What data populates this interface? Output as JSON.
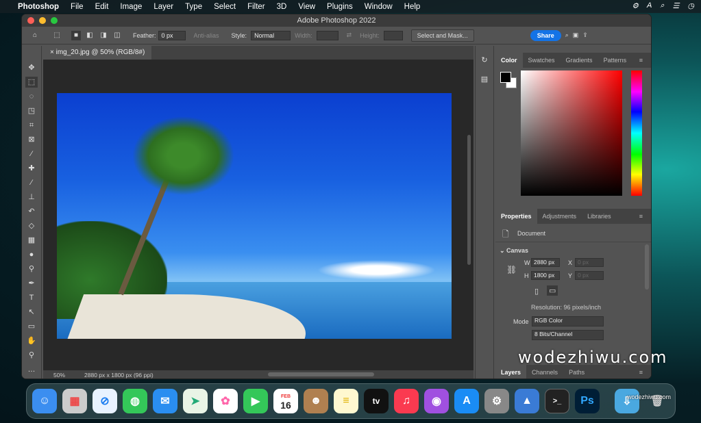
{
  "menubar": {
    "app": "Photoshop",
    "items": [
      "File",
      "Edit",
      "Image",
      "Layer",
      "Type",
      "Select",
      "Filter",
      "3D",
      "View",
      "Plugins",
      "Window",
      "Help"
    ]
  },
  "window": {
    "title": "Adobe Photoshop 2022"
  },
  "options": {
    "feather_label": "Feather:",
    "feather_value": "0 px",
    "antialias": "Anti-alias",
    "style_label": "Style:",
    "style_value": "Normal",
    "width_label": "Width:",
    "height_label": "Height:",
    "select_mask": "Select and Mask...",
    "share": "Share"
  },
  "document": {
    "tab": "img_20.jpg @ 50% (RGB/8#)",
    "zoom": "50%",
    "size": "2880 px x 1800 px (96 ppi)"
  },
  "color_panel": {
    "tabs": [
      "Color",
      "Swatches",
      "Gradients",
      "Patterns"
    ]
  },
  "properties": {
    "tabs": [
      "Properties",
      "Adjustments",
      "Libraries"
    ],
    "doc_label": "Document",
    "section": "Canvas",
    "w_label": "W",
    "w_value": "2880 px",
    "h_label": "H",
    "h_value": "1800 px",
    "x_label": "X",
    "x_value": "0 px",
    "y_label": "Y",
    "y_value": "0 px",
    "resolution": "Resolution: 96 pixels/inch",
    "mode_label": "Mode",
    "mode_value": "RGB Color",
    "depth_value": "8 Bits/Channel"
  },
  "layers_panel": {
    "tabs": [
      "Layers",
      "Channels",
      "Paths"
    ]
  },
  "dock": {
    "calendar_month": "FEB",
    "calendar_day": "16",
    "ps": "Ps",
    "tv": "tv"
  },
  "watermark": "wodezhiwu.com",
  "watermark_small": "wodezhiwu.com"
}
